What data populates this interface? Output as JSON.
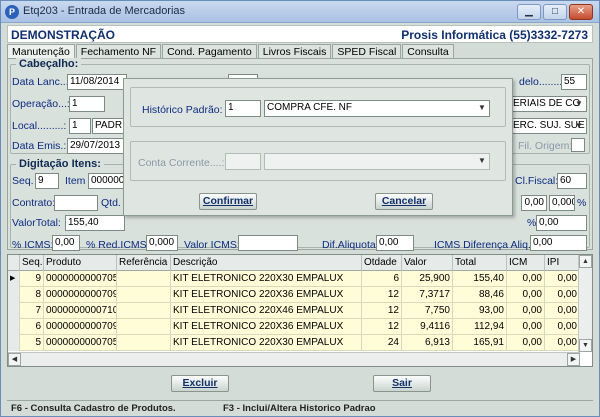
{
  "window": {
    "title": "Etq203 - Entrada de Mercadorias",
    "app_icon": "P"
  },
  "brand": {
    "left": "DEMONSTRAÇÃO",
    "right": "Prosis Informática (55)3332-7273"
  },
  "tabs": [
    {
      "label": "Manutenção"
    },
    {
      "label": "Fechamento NF"
    },
    {
      "label": "Cond. Pagamento"
    },
    {
      "label": "Livros Fiscais"
    },
    {
      "label": "SPED Fiscal"
    },
    {
      "label": "Consulta"
    }
  ],
  "header": {
    "title": "Cabeçalho:",
    "data_lanc_label": "Data Lanc...:",
    "data_lanc": "11/08/2014",
    "operacao_label": "Operação...:",
    "operacao": "1",
    "local_label": "Local.........:",
    "local": "1",
    "local_desc": "PADR",
    "data_emis_label": "Data Emis.:",
    "data_emis": "29/07/2013",
    "modelo_label": "delo...........:",
    "modelo": "55",
    "materiais": "ERIAIS DE CO",
    "merc": "ERC. SUJ. SUE",
    "fil_origem_label": "Fil. Origem:"
  },
  "digitacao": {
    "title": "Digitação Itens:",
    "seq_label": "Seq.",
    "seq": "9",
    "item_label": "Item",
    "item": "0000000",
    "clfiscal_label": "Cl.Fiscal:",
    "clfiscal": "60",
    "contrato_label": "Contrato:",
    "qtd_label": "Qtd. I",
    "pct1": "0,00",
    "pct2": "0,000",
    "pct_sign": "%",
    "valortotal_label": "ValorTotal:",
    "valortotal": "155,40",
    "pct3_sign": "%",
    "pct3": "0,00",
    "icms_label": "% ICMS:",
    "icms": "0,00",
    "red_icms_label": "% Red.ICMS:",
    "red_icms": "0,000",
    "valor_icms_label": "Valor ICMS:",
    "dif_aliq_label": "Dif.Aliquota:",
    "dif_aliq": "0,00",
    "icms_dif_label": "ICMS Diferença Aliq.:",
    "icms_dif": "0,00"
  },
  "modal": {
    "historico_label": "Histórico Padrão:",
    "historico_code": "1",
    "historico_desc": "COMPRA CFE. NF",
    "conta_label": "Conta Corrente....:",
    "confirm": "Confirmar",
    "cancel": "Cancelar"
  },
  "table": {
    "columns": [
      "Seq.",
      "Produto",
      "Referência",
      "Descrição",
      "Otdade",
      "Valor",
      "Total",
      "ICM",
      "IPI"
    ],
    "rows": [
      {
        "seq": "9",
        "produto": "0000000000705",
        "ref": "",
        "desc": "KIT ELETRONICO 220X30 EMPALUX",
        "qtd": "6",
        "valor": "25,900",
        "total": "155,40",
        "icm": "0,00",
        "ipi": "0,00",
        "current": true
      },
      {
        "seq": "8",
        "produto": "0000000000709",
        "ref": "",
        "desc": "KIT ELETRONICO 220X36 EMPALUX",
        "qtd": "12",
        "valor": "7,3717",
        "total": "88,46",
        "icm": "0,00",
        "ipi": "0,00",
        "current": false
      },
      {
        "seq": "7",
        "produto": "0000000000710",
        "ref": "",
        "desc": "KIT ELETRONICO 220X46 EMPALUX",
        "qtd": "12",
        "valor": "7,750",
        "total": "93,00",
        "icm": "0,00",
        "ipi": "0,00",
        "current": false
      },
      {
        "seq": "6",
        "produto": "0000000000709",
        "ref": "",
        "desc": "KIT ELETRONICO 220X36 EMPALUX",
        "qtd": "12",
        "valor": "9,4116",
        "total": "112,94",
        "icm": "0,00",
        "ipi": "0,00",
        "current": false
      },
      {
        "seq": "5",
        "produto": "0000000000705",
        "ref": "",
        "desc": "KIT ELETRONICO 220X30 EMPALUX",
        "qtd": "24",
        "valor": "6,913",
        "total": "165,91",
        "icm": "0,00",
        "ipi": "0,00",
        "current": false
      }
    ]
  },
  "buttons": {
    "excluir": "Excluir",
    "sair": "Sair"
  },
  "status": {
    "left": "F6 - Consulta Cadastro de Produtos.",
    "right": "F3 - Inclui/Altera Historico Padrao"
  },
  "icons": {
    "minimize": "minimize-icon",
    "maximize": "maximize-icon",
    "close": "close-icon"
  }
}
